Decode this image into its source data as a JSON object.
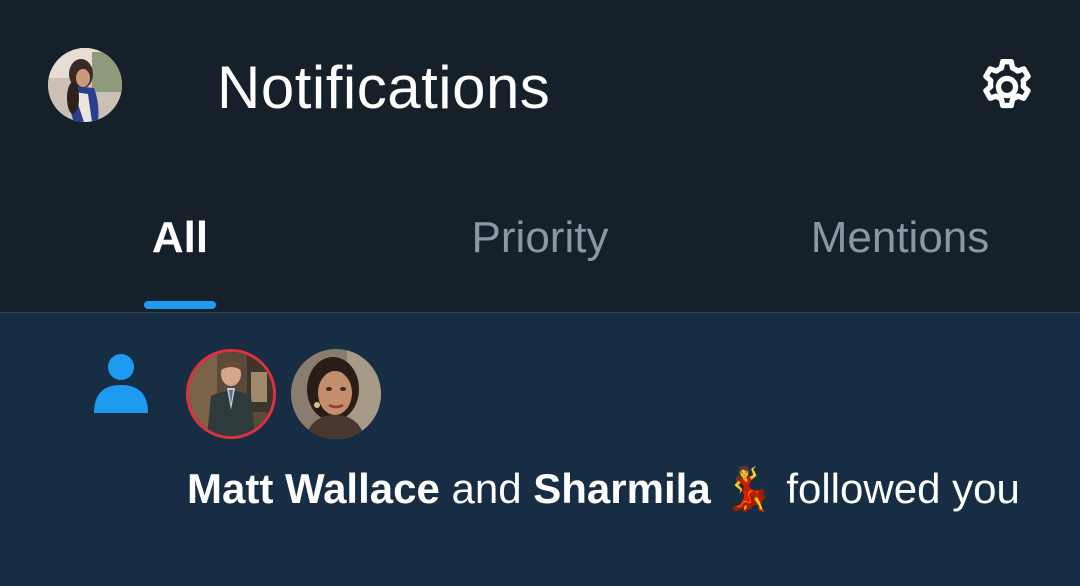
{
  "header": {
    "title": "Notifications",
    "avatar_icon": "user-avatar",
    "settings_icon": "gear-icon"
  },
  "tabs": [
    {
      "label": "All",
      "active": true
    },
    {
      "label": "Priority",
      "active": false
    },
    {
      "label": "Mentions",
      "active": false
    }
  ],
  "notification": {
    "type_icon": "person-icon",
    "user1": "Matt Wallace",
    "connector": "and",
    "user2": "Sharmila",
    "emoji": "💃",
    "action": "followed you"
  },
  "colors": {
    "background": "#15202b",
    "unread_background": "#172d44",
    "accent": "#1d9bf0",
    "muted_text": "#8899a6",
    "ring": "#e0303f"
  }
}
